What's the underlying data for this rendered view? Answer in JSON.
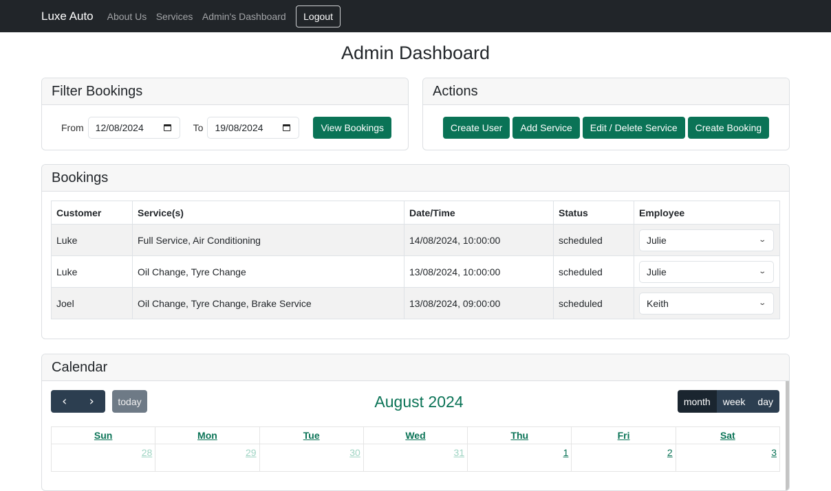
{
  "navbar": {
    "brand": "Luxe Auto",
    "links": [
      "About Us",
      "Services",
      "Admin's Dashboard"
    ],
    "logout_label": "Logout"
  },
  "page_title": "Admin Dashboard",
  "filter": {
    "title": "Filter Bookings",
    "from_label": "From",
    "from_value": "12/08/2024",
    "to_label": "To",
    "to_value": "19/08/2024",
    "view_button": "View Bookings"
  },
  "actions": {
    "title": "Actions",
    "buttons": [
      "Create User",
      "Add Service",
      "Edit / Delete Service",
      "Create Booking"
    ]
  },
  "bookings": {
    "title": "Bookings",
    "columns": [
      "Customer",
      "Service(s)",
      "Date/Time",
      "Status",
      "Employee"
    ],
    "rows": [
      {
        "customer": "Luke",
        "services": "Full Service, Air Conditioning",
        "datetime": "14/08/2024, 10:00:00",
        "status": "scheduled",
        "employee": "Julie"
      },
      {
        "customer": "Luke",
        "services": "Oil Change, Tyre Change",
        "datetime": "13/08/2024, 10:00:00",
        "status": "scheduled",
        "employee": "Julie"
      },
      {
        "customer": "Joel",
        "services": "Oil Change, Tyre Change, Brake Service",
        "datetime": "13/08/2024, 09:00:00",
        "status": "scheduled",
        "employee": "Keith"
      }
    ]
  },
  "calendar": {
    "title": "Calendar",
    "month_title": "August 2024",
    "prev_icon": "chevron-left-icon",
    "next_icon": "chevron-right-icon",
    "today_label": "today",
    "views": [
      "month",
      "week",
      "day"
    ],
    "active_view": "month",
    "weekdays": [
      "Sun",
      "Mon",
      "Tue",
      "Wed",
      "Thu",
      "Fri",
      "Sat"
    ],
    "first_week": [
      {
        "day": "28",
        "other_month": true
      },
      {
        "day": "29",
        "other_month": true
      },
      {
        "day": "30",
        "other_month": true
      },
      {
        "day": "31",
        "other_month": true
      },
      {
        "day": "1",
        "other_month": false
      },
      {
        "day": "2",
        "other_month": false
      },
      {
        "day": "3",
        "other_month": false
      }
    ]
  },
  "colors": {
    "brand_green": "#0a7356",
    "navbar_bg": "#212529",
    "calendar_nav": "#2c3e50"
  }
}
